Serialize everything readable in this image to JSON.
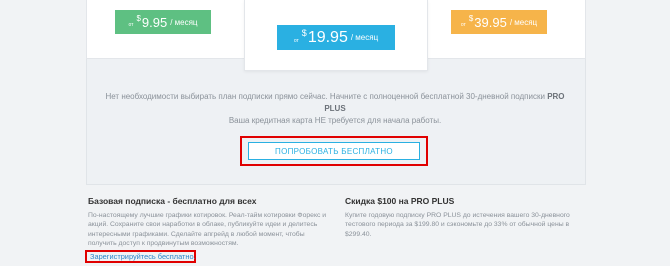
{
  "plans": {
    "left": {
      "from": "от",
      "currency": "$",
      "amount": "9.95",
      "period": "/ месяц",
      "color": "#5ec082"
    },
    "mid": {
      "from": "от",
      "currency": "$",
      "amount": "19.95",
      "period": "/ месяц",
      "color": "#2ab0e2"
    },
    "right": {
      "from": "от",
      "currency": "$",
      "amount": "39.95",
      "period": "/ месяц",
      "color": "#f6b44a"
    }
  },
  "trial": {
    "line1": "Нет необходимости выбирать план подписки прямо сейчас. Начните с полноценной бесплатной 30-дневной подписки",
    "plan_name": "PRO PLUS",
    "line2": "Ваша кредитная карта НЕ требуется для начала работы.",
    "button_label": "ПОПРОБОВАТЬ БЕСПЛАТНО"
  },
  "basic": {
    "title": "Базовая подписка - бесплатно для всех",
    "text": "По-настоящему лучшие графики котировок. Реал-тайм котировки Форекс и акций. Сохраните свои наработки в облаке, публикуйте идеи и делитесь интересными графиками. Сделайте апгрейд в любой момент, чтобы получить доступ к продвинутым возможностям.",
    "link": "Зарегистрируйтесь бесплатно."
  },
  "discount": {
    "title": "Скидка $100 на PRO PLUS",
    "text": "Купите годовую подписку PRO PLUS до истечения вашего 30-дневного тестового периода за $199.80 и сэкономьте до 33% от обычной цены в $299.40."
  }
}
